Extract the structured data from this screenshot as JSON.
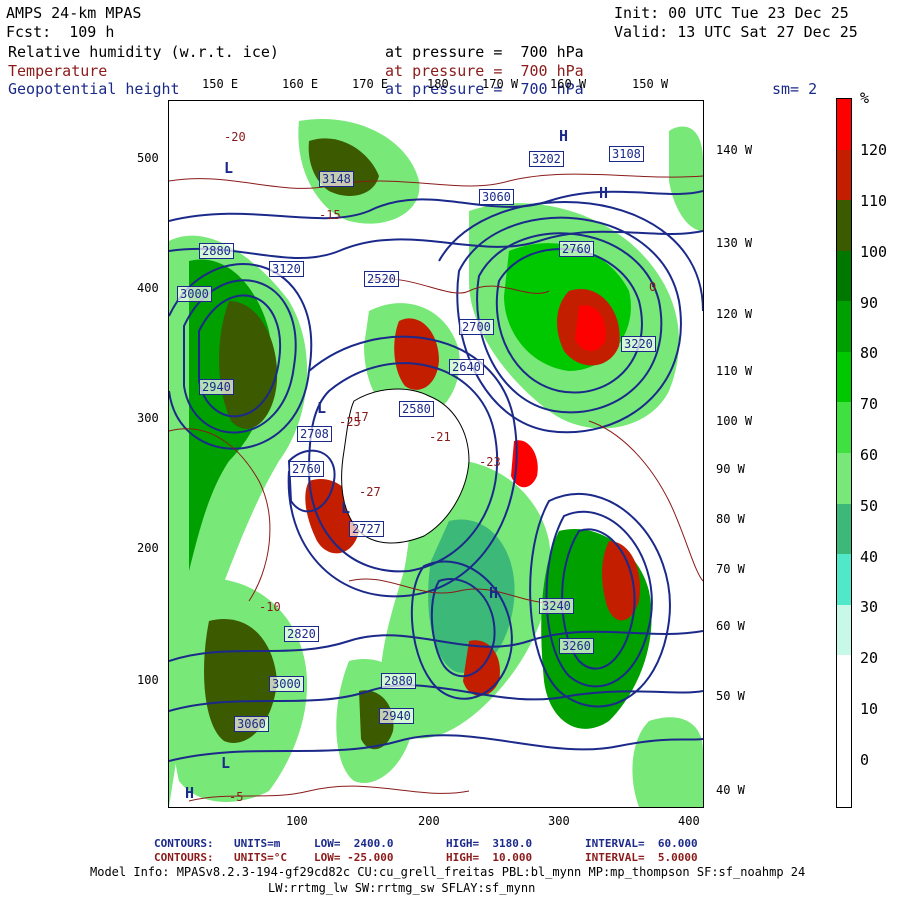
{
  "header": {
    "model": "AMPS 24-km MPAS",
    "fcst": "Fcst:  109 h",
    "init": "Init: 00 UTC Tue 23 Dec 25",
    "valid": "Valid: 13 UTC Sat 27 Dec 25",
    "fields": [
      {
        "name": "Relative humidity (w.r.t. ice)",
        "level": "at pressure =  700 hPa",
        "color": "#000000"
      },
      {
        "name": "Temperature",
        "level": "at pressure =  700 hPa",
        "color": "#8b1a1a"
      },
      {
        "name": "Geopotential height",
        "level": "at pressure =  700 hPa",
        "color": "#1b2a8a"
      }
    ],
    "smooth": "sm= 2"
  },
  "top_ticks": [
    "150 E",
    "160 E",
    "170 E",
    "180",
    "170 W",
    "160 W",
    "150 W"
  ],
  "right_ticks": [
    "140 W",
    "130 W",
    "120 W",
    "110 W",
    "100 W",
    "90 W",
    "80 W",
    "70 W",
    "60 W",
    "50 W",
    "40 W"
  ],
  "left_ticks": [
    "500",
    "400",
    "300",
    "200",
    "100"
  ],
  "bottom_ticks": [
    "100",
    "200",
    "300",
    "400"
  ],
  "color_scale": {
    "unit": "%",
    "labels": [
      "120",
      "110",
      "100",
      "90",
      "80",
      "70",
      "60",
      "50",
      "40",
      "30",
      "20",
      "10",
      "0"
    ],
    "colors": [
      "#ff0000",
      "#c41e00",
      "#3c5a00",
      "#007800",
      "#00a000",
      "#00c800",
      "#40e040",
      "#78e878",
      "#3cb878",
      "#50e8c8",
      "#c8f8e8",
      "#ffffff",
      "#ffffff",
      "#ffffff"
    ]
  },
  "map": {
    "height_labels": [
      "2880",
      "2940",
      "3000",
      "3060",
      "3120",
      "2820",
      "2760",
      "2700",
      "2640",
      "2580",
      "2520",
      "3202",
      "3108",
      "3148",
      "2727",
      "2760",
      "2708",
      "3220",
      "3240",
      "3260",
      "3000",
      "3060",
      "2940",
      "2880"
    ],
    "highs": [
      "H",
      "H",
      "H",
      "H"
    ],
    "lows": [
      "L",
      "L",
      "L",
      "L"
    ],
    "temp_labels": [
      "-20",
      "-15",
      "-10",
      "-5",
      "0",
      "-25",
      "-23",
      "-17",
      "-21",
      "-27"
    ]
  },
  "footer": {
    "height_line": {
      "label": "CONTOURS:",
      "units": "UNITS=m",
      "low": "LOW=  2400.0",
      "high": "HIGH=  3180.0",
      "interval": "INTERVAL=  60.000"
    },
    "temp_line": {
      "label": "CONTOURS:",
      "units": "UNITS=°C",
      "low": "LOW= -25.000",
      "high": "HIGH=  10.000",
      "interval": "INTERVAL=  5.0000"
    },
    "model_info_1": "Model Info: MPASv8.2.3-194-gf29cd82c CU:cu_grell_freitas PBL:bl_mynn MP:mp_thompson SF:sf_noahmp 24",
    "model_info_2": "LW:rrtmg_lw SW:rrtmg_sw SFLAY:sf_mynn"
  }
}
